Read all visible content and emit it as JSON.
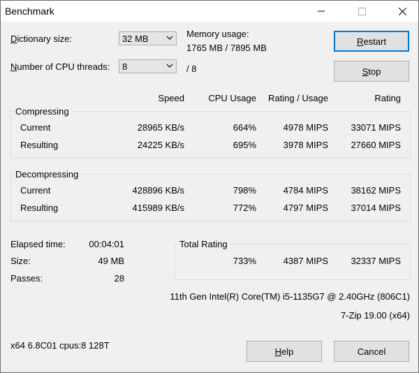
{
  "window": {
    "title": "Benchmark"
  },
  "settings": {
    "dict_label_prefix": "",
    "dict_label_mnemonic": "D",
    "dict_label_rest": "ictionary size:",
    "dict_value": "32 MB",
    "threads_label_prefix": "",
    "threads_label_mnemonic": "N",
    "threads_label_rest": "umber of CPU threads:",
    "threads_value": "8",
    "threads_total": "/ 8",
    "memory_label": "Memory usage:",
    "memory_value": "1765 MB / 7895 MB"
  },
  "buttons": {
    "restart_mnemonic": "R",
    "restart_rest": "estart",
    "stop_mnemonic": "S",
    "stop_rest": "top",
    "help_mnemonic": "H",
    "help_rest": "elp",
    "cancel": "Cancel"
  },
  "columns": {
    "speed": "Speed",
    "cpu_usage": "CPU Usage",
    "rating_usage": "Rating / Usage",
    "rating": "Rating"
  },
  "compressing": {
    "title": "Compressing",
    "rows": [
      {
        "label": "Current",
        "speed": "28965 KB/s",
        "cpu": "664%",
        "ru": "4978 MIPS",
        "rating": "33071 MIPS"
      },
      {
        "label": "Resulting",
        "speed": "24225 KB/s",
        "cpu": "695%",
        "ru": "3978 MIPS",
        "rating": "27660 MIPS"
      }
    ]
  },
  "decompressing": {
    "title": "Decompressing",
    "rows": [
      {
        "label": "Current",
        "speed": "428896 KB/s",
        "cpu": "798%",
        "ru": "4784 MIPS",
        "rating": "38162 MIPS"
      },
      {
        "label": "Resulting",
        "speed": "415989 KB/s",
        "cpu": "772%",
        "ru": "4797 MIPS",
        "rating": "37014 MIPS"
      }
    ]
  },
  "stats": {
    "elapsed_label": "Elapsed time:",
    "elapsed_value": "00:04:01",
    "size_label": "Size:",
    "size_value": "49 MB",
    "passes_label": "Passes:",
    "passes_value": "28"
  },
  "total": {
    "title": "Total Rating",
    "cpu": "733%",
    "ru": "4387 MIPS",
    "rating": "32337 MIPS"
  },
  "system": {
    "cpu_name": "11th Gen Intel(R) Core(TM) i5-1135G7 @ 2.40GHz (806C1)",
    "version": "7-Zip 19.00 (x64)",
    "arch": "x64 6.8C01 cpus:8 128T"
  },
  "icons": {
    "minimize": "minimize-icon",
    "maximize": "maximize-icon",
    "close": "close-icon",
    "dropdown": "chevron-down-icon"
  }
}
